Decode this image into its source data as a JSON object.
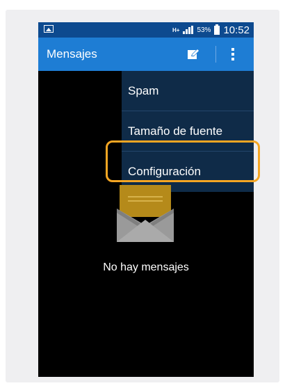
{
  "status_bar": {
    "network_type": "H+",
    "battery_percent": "53%",
    "time": "10:52"
  },
  "action_bar": {
    "title": "Mensajes",
    "compose_icon": "compose-icon",
    "overflow_icon": "more-vertical-icon"
  },
  "menu": {
    "items": [
      {
        "label": "Spam"
      },
      {
        "label": "Tamaño de fuente"
      },
      {
        "label": "Configuración"
      }
    ]
  },
  "empty_state": {
    "icon": "envelope-icon",
    "message": "No hay mensajes"
  },
  "colors": {
    "status_bar": "#0d4a8f",
    "action_bar": "#1e7dd4",
    "menu_background": "#0f2b48",
    "highlight": "#f5a623",
    "screen_background": "#000000"
  }
}
